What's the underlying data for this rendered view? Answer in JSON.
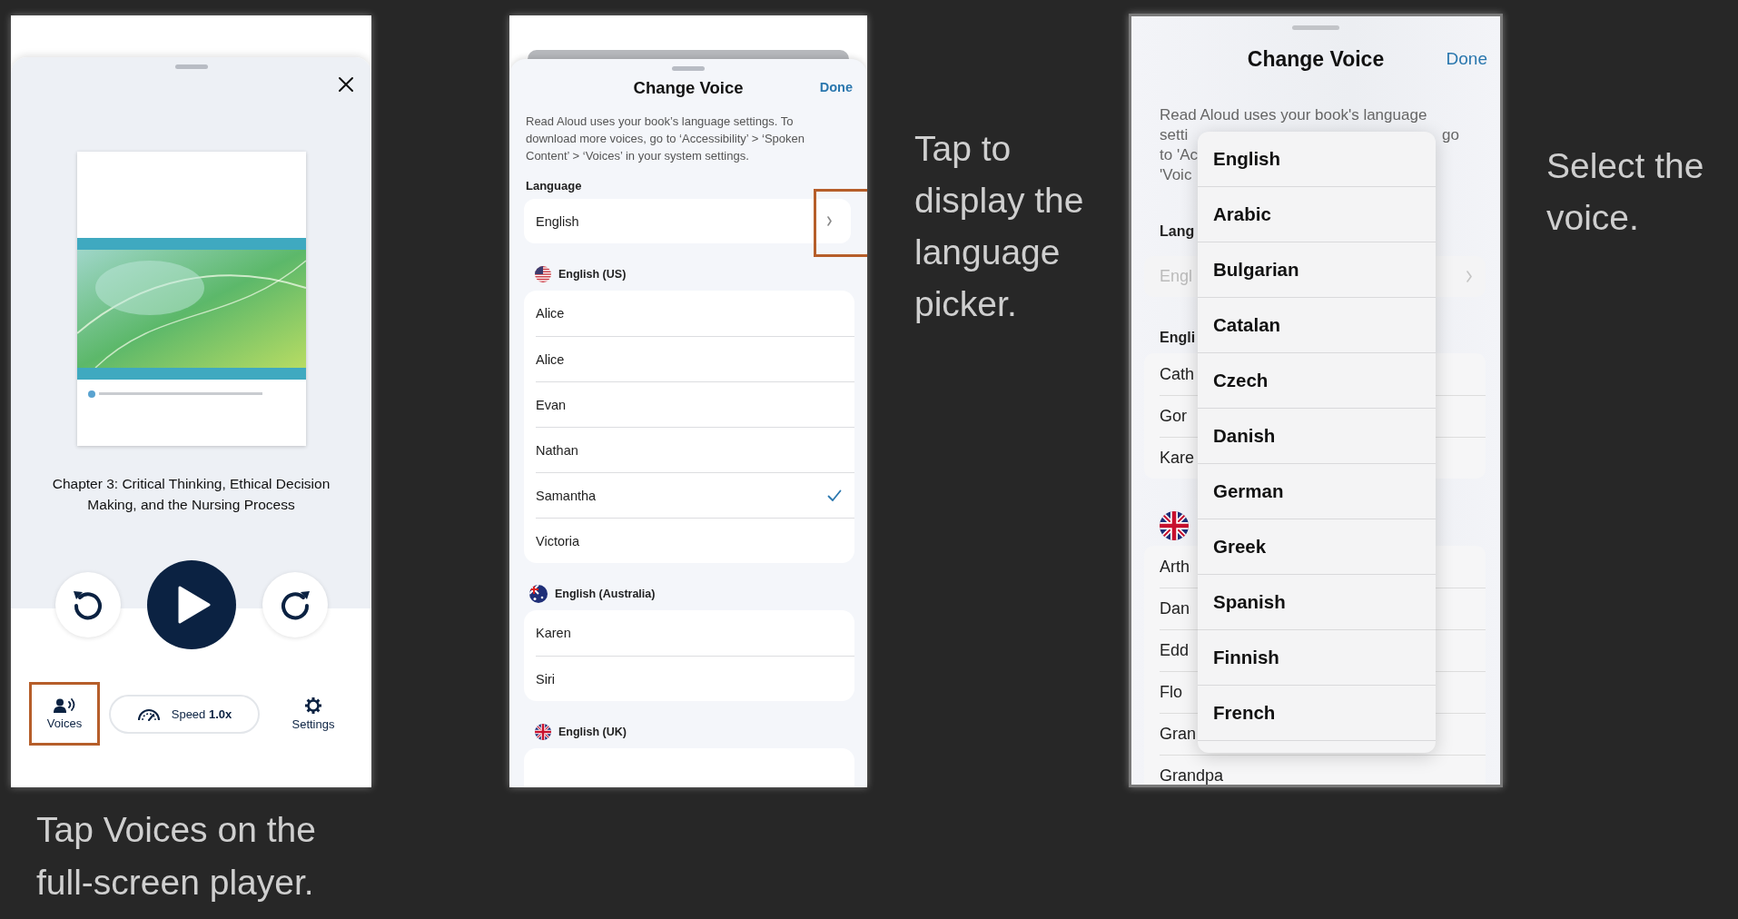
{
  "player": {
    "chapter_title": "Chapter 3: Critical Thinking, Ethical Decision Making, and the Nursing Process",
    "toolbar": [
      {
        "kind": "voices",
        "label": "Voices",
        "highlighted": true
      },
      {
        "kind": "speed",
        "label": "Speed **1.0x**",
        "highlighted": false
      },
      {
        "kind": "settings",
        "label": "Settings",
        "highlighted": false
      }
    ],
    "caption": "Tap Voices on the full-screen player."
  },
  "change_voice": {
    "title": "Change Voice",
    "done": "Done",
    "description": "Read Aloud uses your book’s language settings. To download more voices, go to ‘Accessibility’ > ‘Spoken Content’ > ‘Voices’ in your system settings.",
    "language_label": "Language",
    "language": {
      "value": "English",
      "highlighted": true
    },
    "sections": [
      {
        "kind": "us",
        "header": "English (US)",
        "voices": [
          {
            "name": "Alice",
            "selected": false
          },
          {
            "name": "Alice",
            "selected": false
          },
          {
            "name": "Evan",
            "selected": false
          },
          {
            "name": "Nathan",
            "selected": false
          },
          {
            "name": "Samantha",
            "selected": true
          },
          {
            "name": "Victoria",
            "selected": false
          }
        ]
      },
      {
        "kind": "au",
        "header": "English (Australia)",
        "voices": [
          {
            "name": "Karen",
            "selected": false
          },
          {
            "name": "Siri",
            "selected": false
          }
        ]
      },
      {
        "kind": "uk",
        "header": "English (UK)"
      }
    ],
    "caption": "Tap to display the language picker."
  },
  "language_picker": {
    "title": "Change Voice",
    "done": "Done",
    "description_lines": [
      {
        "left": "Read Aloud uses your book's language"
      },
      {
        "left": "setti",
        "right": "go"
      },
      {
        "left": "to 'Ac"
      },
      {
        "left": "'Voic"
      }
    ],
    "language_label": "Lang",
    "language": {
      "value": "Engl",
      "disabled": true
    },
    "sections": [
      {
        "header": "Engli",
        "voices": [
          "Cath",
          "Gor",
          "Kare"
        ]
      },
      {
        "kind": "uk",
        "voices": [
          "Arth",
          "Dan",
          "Edd",
          "Flo",
          "Gran",
          "Grandpa"
        ]
      }
    ],
    "menu": [
      "English",
      "Arabic",
      "Bulgarian",
      "Catalan",
      "Czech",
      "Danish",
      "German",
      "Greek",
      "Spanish",
      "Finnish",
      "French"
    ],
    "caption": "Select the voice."
  }
}
